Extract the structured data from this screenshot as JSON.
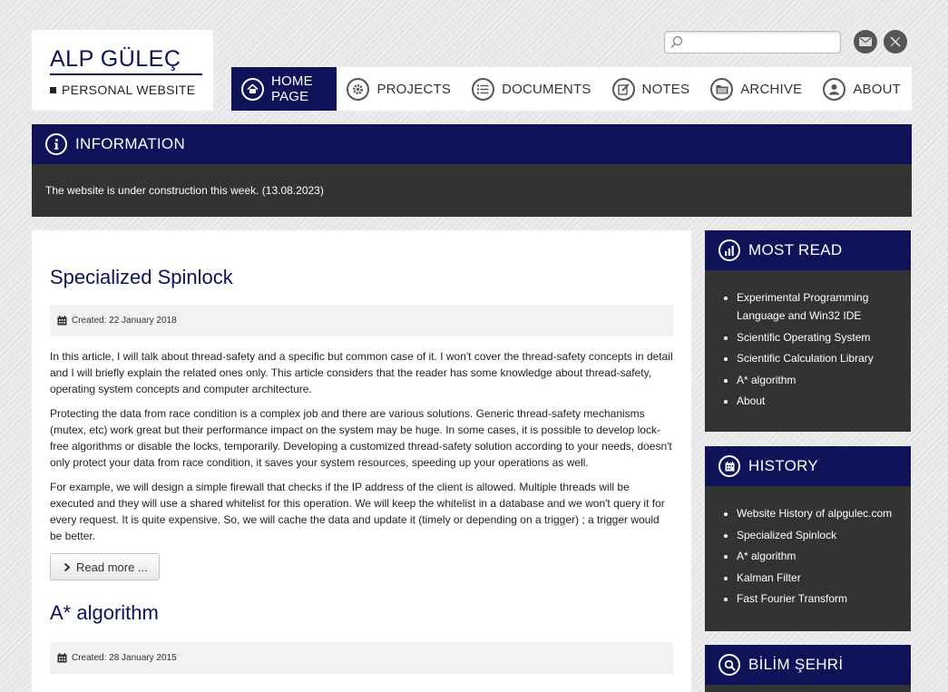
{
  "logo": {
    "name": "ALP GÜLEÇ",
    "subtitle": "PERSONAL WEBSITE"
  },
  "search": {
    "value": "",
    "placeholder": ""
  },
  "social": [
    {
      "icon": "mail-icon"
    },
    {
      "icon": "x-twitter-icon"
    }
  ],
  "nav": [
    {
      "label": "HOME PAGE",
      "icon": "home-icon",
      "active": true
    },
    {
      "label": "PROJECTS",
      "icon": "gear-icon"
    },
    {
      "label": "DOCUMENTS",
      "icon": "list-icon"
    },
    {
      "label": "NOTES",
      "icon": "edit-icon"
    },
    {
      "label": "ARCHIVE",
      "icon": "folder-icon"
    },
    {
      "label": "ABOUT",
      "icon": "user-icon"
    }
  ],
  "info": {
    "title": "INFORMATION",
    "message": "The website is under construction this week. (13.08.2023)"
  },
  "articles": [
    {
      "title": "Specialized Spinlock",
      "created": "Created: 22 January 2018",
      "paragraphs": [
        "In this article, I will talk about thread-safety and a specific but common case of it. I won't cover the thread-safety concepts in detail and I will briefly explain the related ones only. This article considers that the reader has some knowledge about thread-safety, operating system concepts and computer architecture.",
        "Protecting the data from race condition is a complex job and there are various solutions. Generic thread-safety mechanisms (mutex, etc) work great but their performance impact on the system may be huge. In some cases, it is possible to develop lock-free algorithms or disable the locks, temporarily. Developing a customized thread-safety solution according to your needs, doesn't only protect your data from race condition, it saves your system resources, speeding up your operations as well.",
        "For example, we will design a simple firewall that checks if the IP address of the client is allowed. Multiple threads will be executed and they will use a shared whitelist for this operation. We will keep the whitelist in a database and we won't query it for every request. It is quite expensive. So, we will cache the data and update it (timely or depending on a trigger) ; a trigger would be better."
      ],
      "read_more": "Read more ..."
    },
    {
      "title": "A* algorithm",
      "created": "Created: 28 January 2015"
    }
  ],
  "sidebar": {
    "most_read": {
      "title": "MOST READ",
      "items": [
        "Experimental Programming Language and Win32 IDE",
        "Scientific Operating System",
        "Scientific Calculation Library",
        "A* algorithm",
        "About"
      ]
    },
    "history": {
      "title": "HISTORY",
      "items": [
        "Website History of alpgulec.com",
        "Specialized Spinlock",
        "A* algorithm",
        "Kalman Filter",
        "Fast Fourier Transform"
      ]
    },
    "bilim": {
      "title": "BİLİM ŞEHRİ"
    }
  },
  "colors": {
    "brand": "#0d1259",
    "dark_panel": "#333333",
    "background": "#e6e6e6"
  }
}
